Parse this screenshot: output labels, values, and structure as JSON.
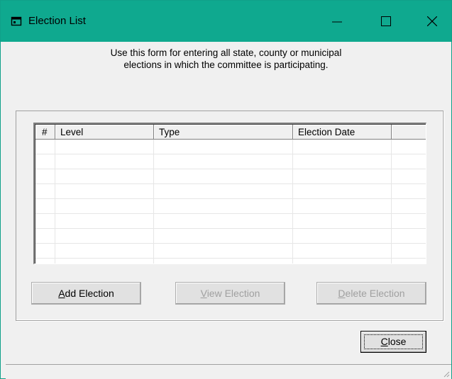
{
  "window": {
    "title": "Election List",
    "icon": "app-window-icon",
    "controls": {
      "minimize": "minimize-icon",
      "maximize": "maximize-icon",
      "close": "close-icon"
    },
    "colors": {
      "titlebar": "#0fa98f",
      "background": "#f0f0f0"
    }
  },
  "form": {
    "description_line1": "Use this form for entering all state, county or municipal",
    "description_line2": "elections in which the committee is participating."
  },
  "grid": {
    "columns": [
      "#",
      "Level",
      "Type",
      "Election Date",
      ""
    ],
    "rows": []
  },
  "buttons": {
    "add": {
      "label_prefix": "",
      "accel": "A",
      "label_rest": "dd Election",
      "enabled": true
    },
    "view": {
      "label_prefix": "",
      "accel": "V",
      "label_rest": "iew Election",
      "enabled": false
    },
    "delete": {
      "label_prefix": "",
      "accel": "D",
      "label_rest": "elete Election",
      "enabled": false
    },
    "close": {
      "label_prefix": "",
      "accel": "C",
      "label_rest": "lose",
      "enabled": true
    }
  }
}
